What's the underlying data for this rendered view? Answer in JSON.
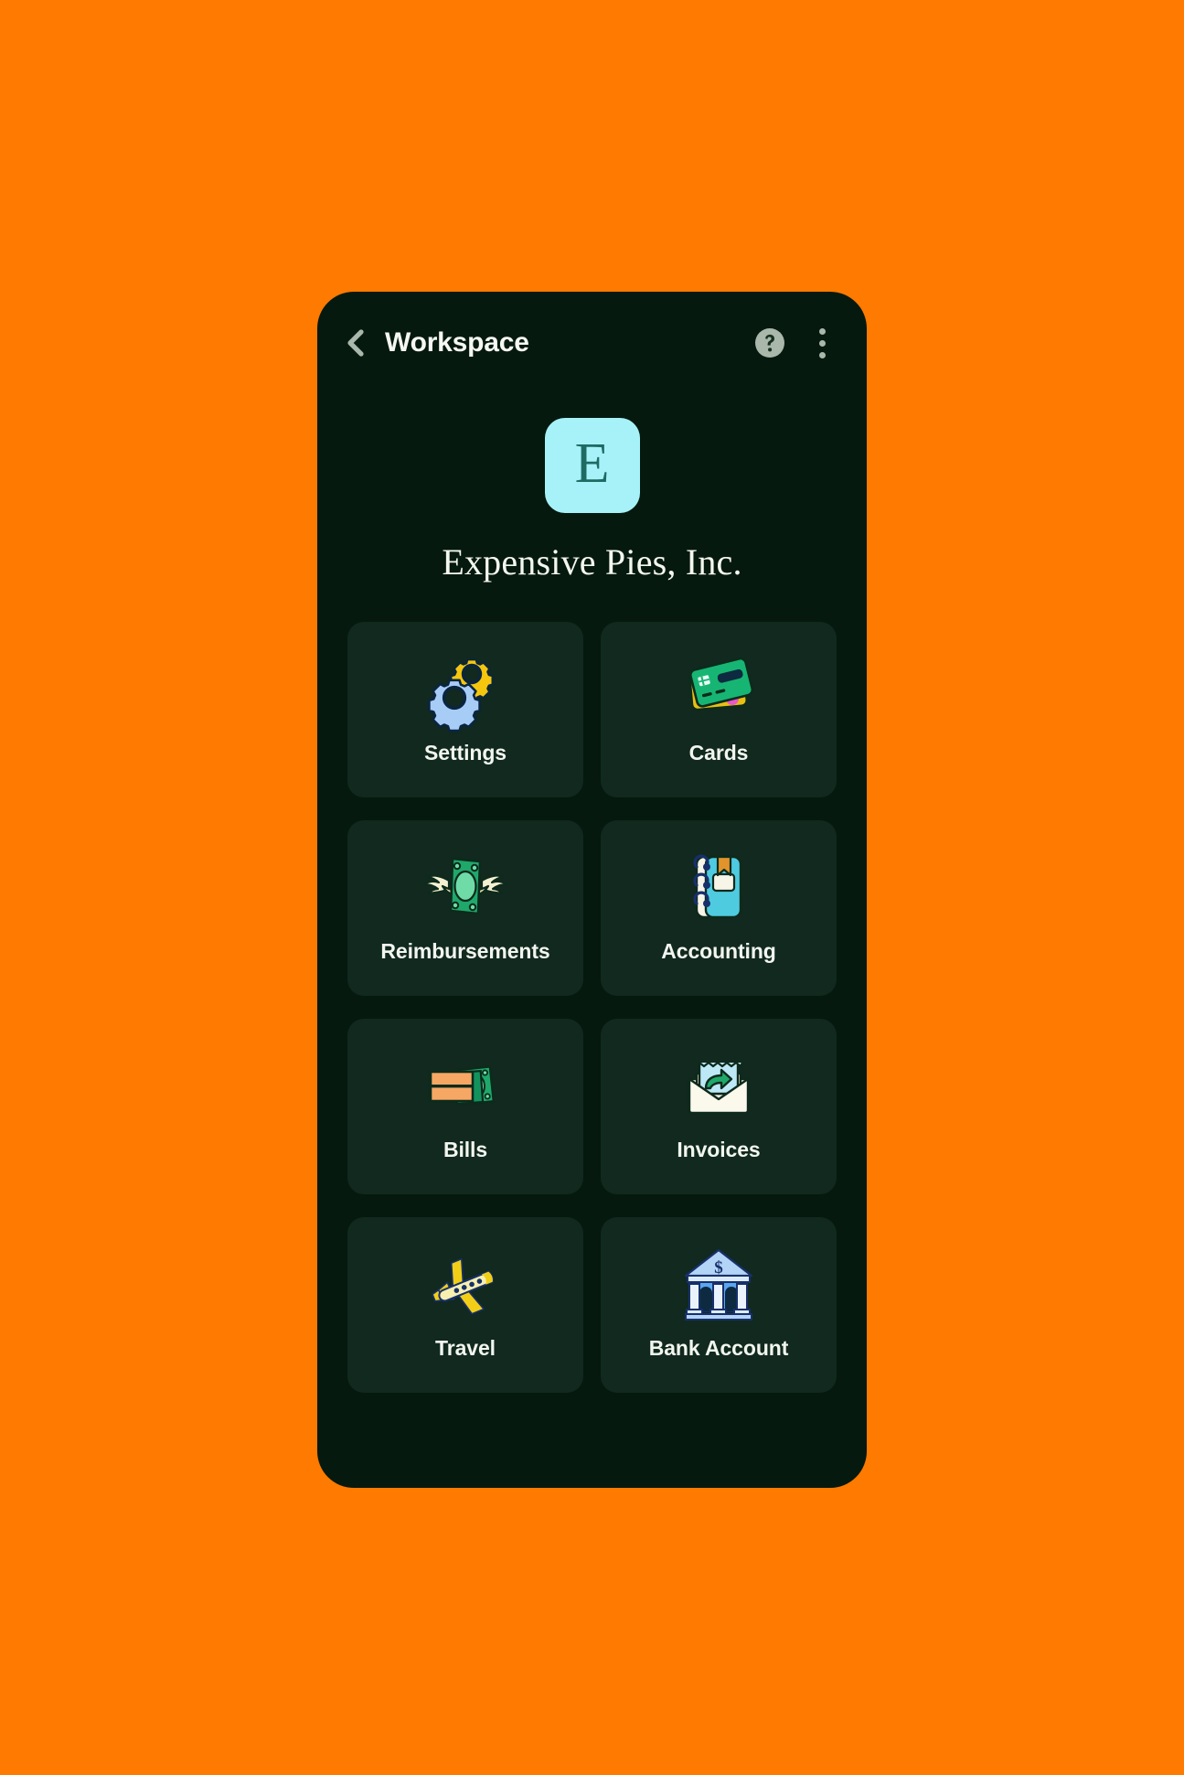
{
  "theme": {
    "page_background": "#FF7A00",
    "phone_background": "#06190F",
    "tile_background": "#11291E",
    "accent_avatar": "#A6F2F8",
    "avatar_text": "#1F6B64",
    "text_primary": "#F2F6F0",
    "icon_muted": "#AAB7AB"
  },
  "appbar": {
    "back_icon": "chevron-left-icon",
    "title": "Workspace",
    "help_icon": "help-circle-icon",
    "overflow_icon": "more-vertical-icon"
  },
  "workspace": {
    "avatar_initial": "E",
    "name": "Expensive Pies, Inc."
  },
  "grid": {
    "tiles": [
      {
        "id": "settings",
        "label": "Settings",
        "icon": "gears-icon"
      },
      {
        "id": "cards",
        "label": "Cards",
        "icon": "credit-cards-icon"
      },
      {
        "id": "reimbursements",
        "label": "Reimbursements",
        "icon": "flying-money-icon"
      },
      {
        "id": "accounting",
        "label": "Accounting",
        "icon": "notebook-icon"
      },
      {
        "id": "bills",
        "label": "Bills",
        "icon": "bills-cash-icon"
      },
      {
        "id": "invoices",
        "label": "Invoices",
        "icon": "envelope-receipt-icon"
      },
      {
        "id": "travel",
        "label": "Travel",
        "icon": "airplane-icon"
      },
      {
        "id": "bank-account",
        "label": "Bank Account",
        "icon": "bank-building-icon"
      }
    ]
  }
}
